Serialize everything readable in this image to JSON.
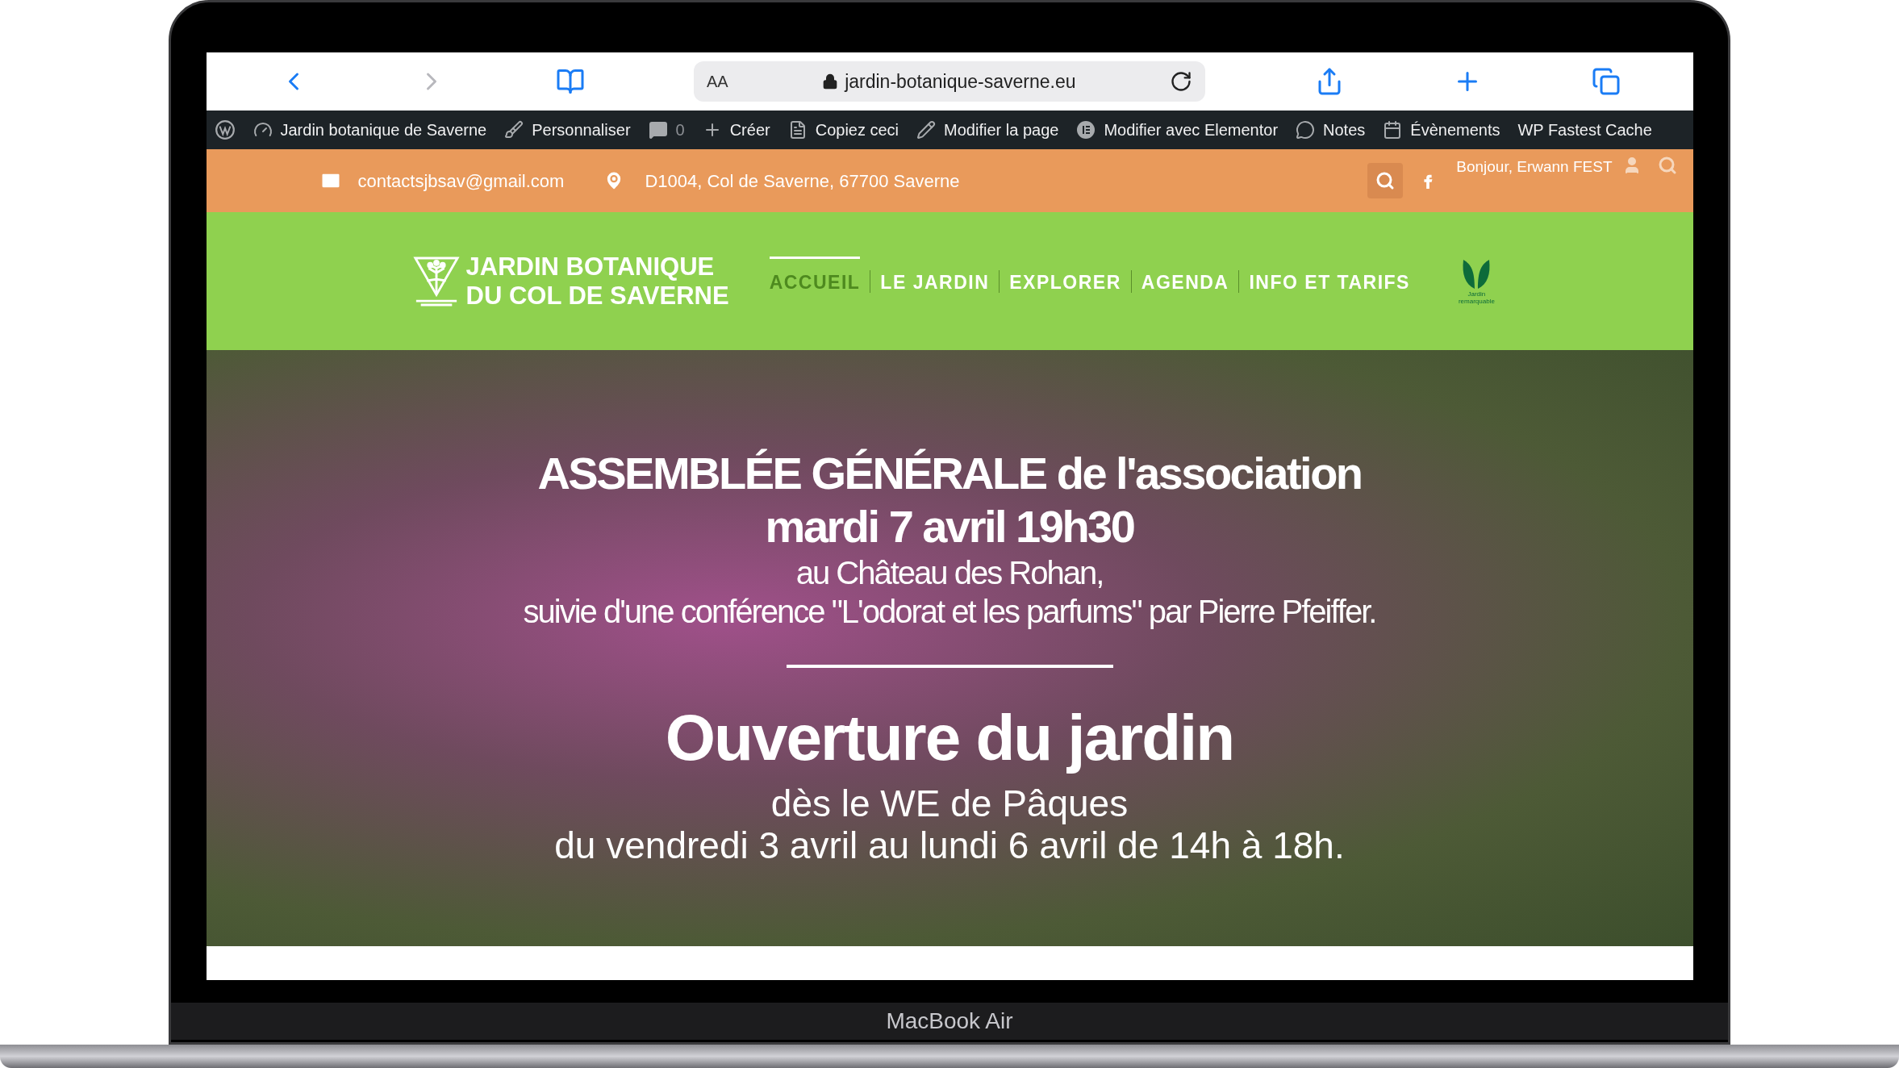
{
  "browser": {
    "reader_label": "AA",
    "url": "jardin-botanique-saverne.eu"
  },
  "admin_bar": {
    "items": [
      {
        "label": "Jardin botanique de Saverne"
      },
      {
        "label": "Personnaliser"
      },
      {
        "label": "0"
      },
      {
        "label": "Créer"
      },
      {
        "label": "Copiez ceci"
      },
      {
        "label": "Modifier la page"
      },
      {
        "label": "Modifier avec Elementor"
      },
      {
        "label": "Notes"
      },
      {
        "label": "Évènements"
      },
      {
        "label": "WP Fastest Cache"
      }
    ]
  },
  "top_bar": {
    "email": "contactsjbsav@gmail.com",
    "address": "D1004, Col de Saverne, 67700 Saverne",
    "greeting": "Bonjour, Erwann FEST"
  },
  "header": {
    "logo_lines": [
      "JARDIN BOTANIQUE",
      "DU COL DE SAVERNE"
    ],
    "nav": [
      {
        "label": "ACCUEIL",
        "selected": true
      },
      {
        "label": "LE JARDIN",
        "selected": false
      },
      {
        "label": "EXPLORER",
        "selected": false
      },
      {
        "label": "AGENDA",
        "selected": false
      },
      {
        "label": "INFO ET TARIFS",
        "selected": false
      }
    ],
    "badge_lines": [
      "Jardin",
      "remarquable"
    ]
  },
  "hero": {
    "event_title": "ASSEMBLÉE GÉNÉRALE de l'association",
    "event_date": "mardi 7 avril 19h30",
    "event_place": "au Château des Rohan,",
    "event_detail": "suivie d'une conférence \"L'odorat et les parfums\" par Pierre Pfeiffer.",
    "opening_title": "Ouverture du jardin",
    "opening_when": "dès le WE de Pâques",
    "opening_dates": "du vendredi 3 avril au lundi 6 avril de 14h à 18h."
  },
  "device": {
    "label": "MacBook Air"
  }
}
